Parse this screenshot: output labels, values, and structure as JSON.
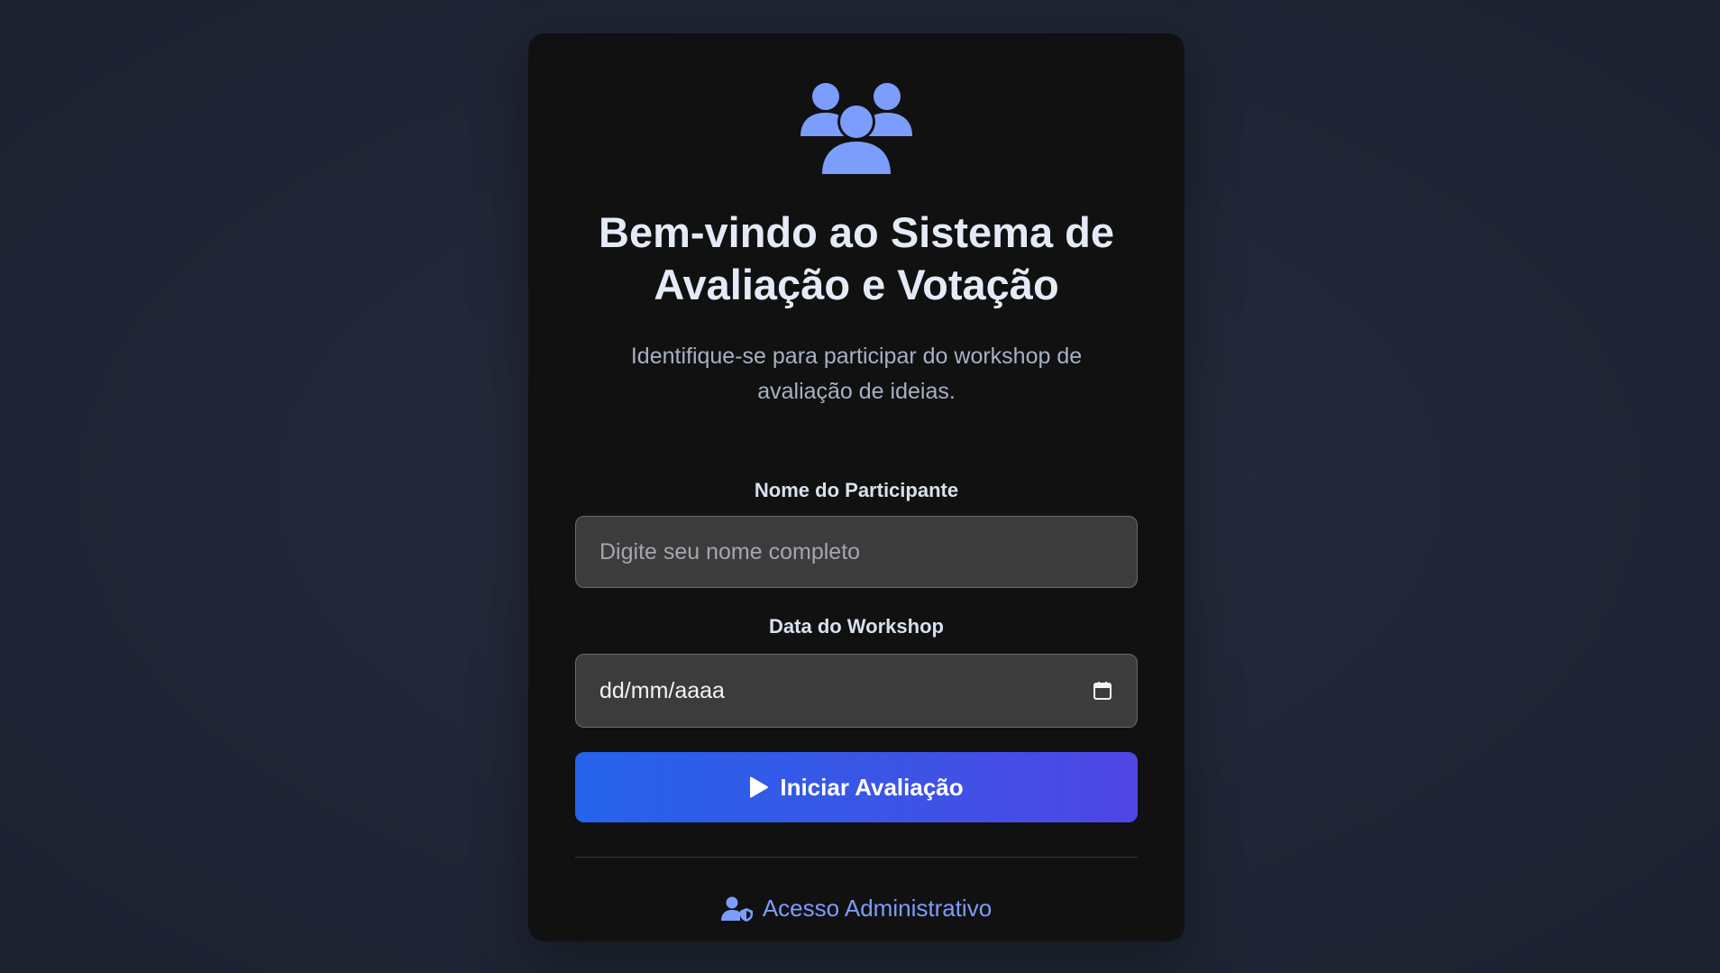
{
  "header": {
    "title": "Bem-vindo ao Sistema de Avaliação e Votação",
    "subtitle": "Identifique-se para participar do workshop de avaliação de ideias."
  },
  "form": {
    "name_label": "Nome do Participante",
    "name_placeholder": "Digite seu nome completo",
    "name_value": "",
    "date_label": "Data do Workshop",
    "date_placeholder": "dd/mm/aaaa",
    "submit_label": "Iniciar Avaliação"
  },
  "admin": {
    "link_label": "Acesso Administrativo"
  },
  "icons": {
    "logo": "users-group-icon",
    "calendar": "calendar-icon",
    "submit": "play-icon",
    "admin": "user-shield-icon"
  },
  "colors": {
    "accent": "#7c9dfc",
    "button_start": "#2563eb",
    "button_end": "#4f46e5",
    "card_bg": "#111112",
    "page_bg": "#212737"
  }
}
